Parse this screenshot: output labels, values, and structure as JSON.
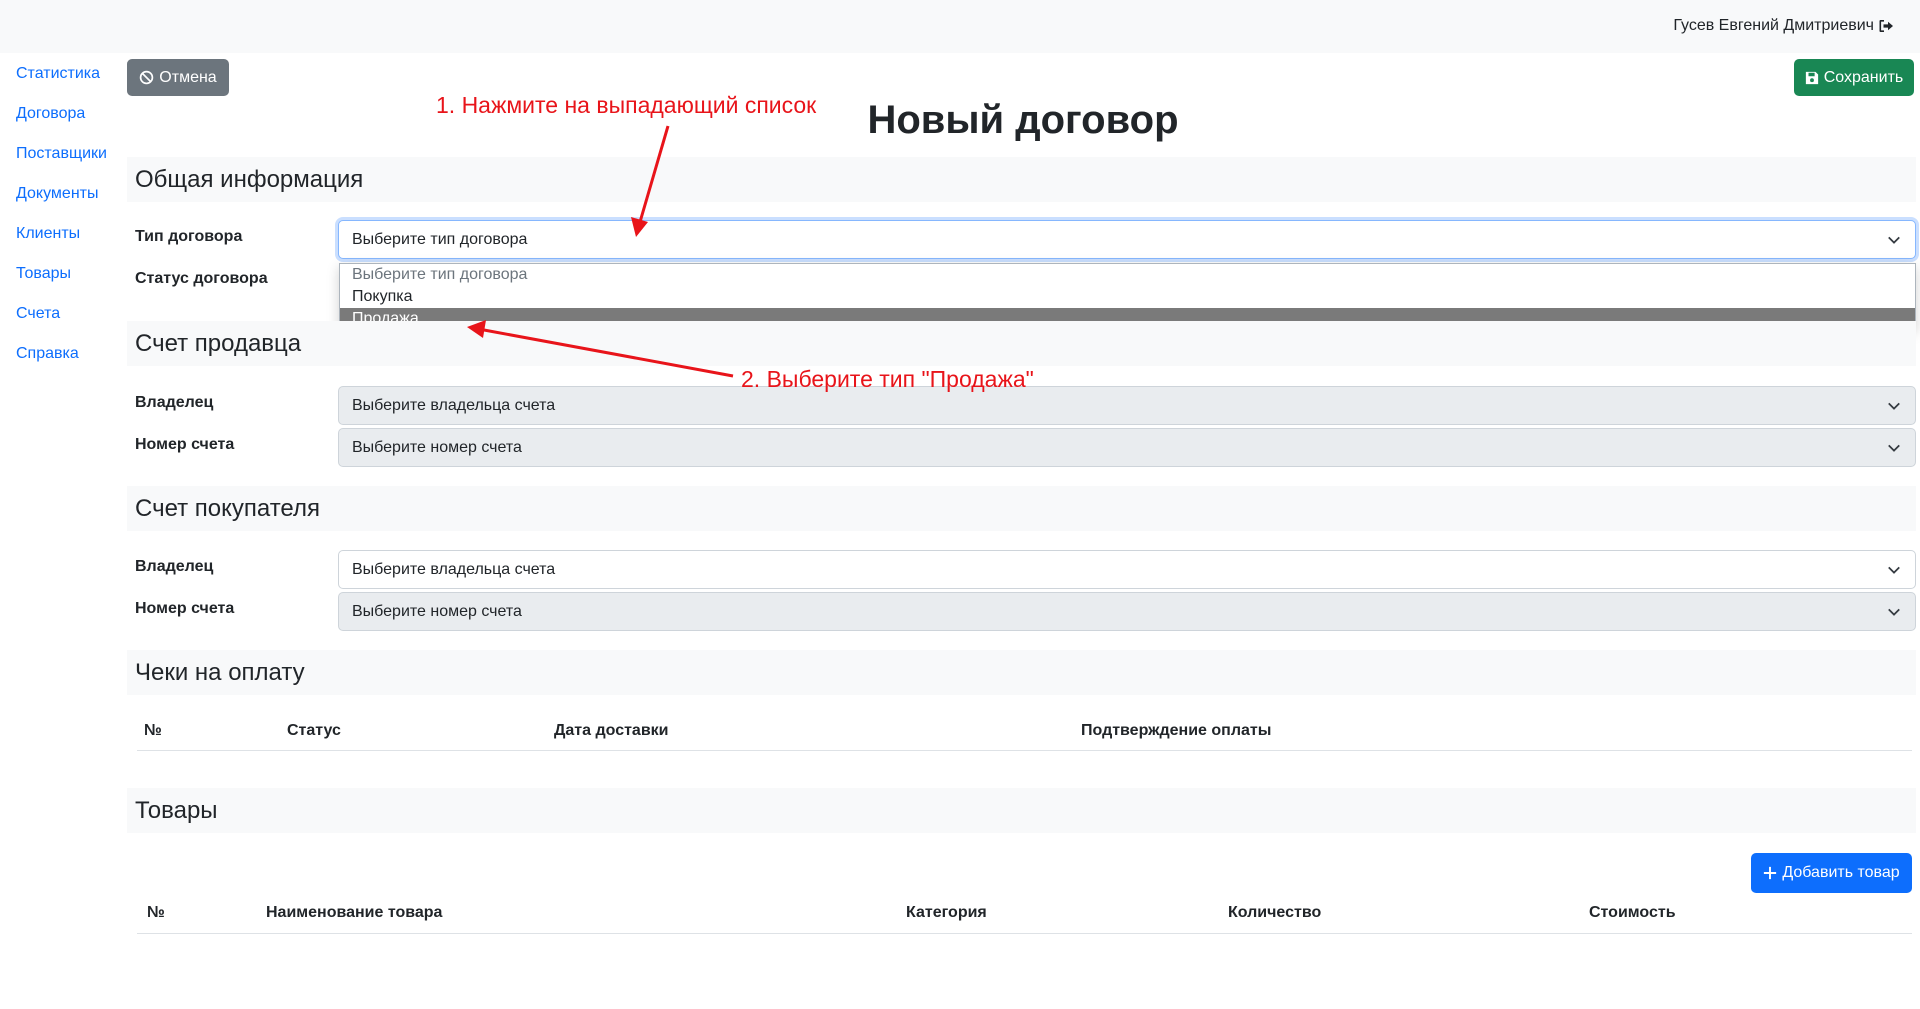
{
  "header": {
    "user_name": "Гусев Евгений Дмитриевич",
    "logout_icon": "sign-out-icon"
  },
  "sidebar": {
    "items": [
      {
        "label": "Статистика"
      },
      {
        "label": "Договора"
      },
      {
        "label": "Поставщики"
      },
      {
        "label": "Документы"
      },
      {
        "label": "Клиенты"
      },
      {
        "label": "Товары"
      },
      {
        "label": "Счета"
      },
      {
        "label": "Справка"
      }
    ]
  },
  "toolbar": {
    "cancel_label": "Отмена",
    "cancel_icon": "ban-icon",
    "save_label": "Сохранить",
    "save_icon": "floppy-disk-icon"
  },
  "page": {
    "title": "Новый договор"
  },
  "general": {
    "title": "Общая информация",
    "type_label": "Тип договора",
    "type_value": "Выберите тип договора",
    "status_label": "Статус договора",
    "dropdown_options": [
      "Выберите тип договора",
      "Покупка",
      "Продажа"
    ],
    "dropdown_selected": "Продажа"
  },
  "seller": {
    "title": "Счет продавца",
    "owner_label": "Владелец",
    "owner_value": "Выберите владельца счета",
    "account_label": "Номер счета",
    "account_value": "Выберите номер счета"
  },
  "buyer": {
    "title": "Счет покупателя",
    "owner_label": "Владелец",
    "owner_value": "Выберите владельца счета",
    "account_label": "Номер счета",
    "account_value": "Выберите номер счета"
  },
  "checks": {
    "title": "Чеки на оплату",
    "columns": [
      "№",
      "Статус",
      "Дата доставки",
      "Подтверждение оплаты"
    ]
  },
  "goods": {
    "title": "Товары",
    "add_label": "Добавить товар",
    "add_icon": "plus-icon",
    "columns": [
      "№",
      "Наименование товара",
      "Категория",
      "Количество",
      "Стоимость"
    ]
  },
  "annotations": {
    "step1": "1. Нажмите на выпадающий список",
    "step2": "2. Выберите тип \"Продажа\"",
    "color": "#e8141a"
  },
  "colors": {
    "primary": "#0d6efd",
    "success": "#198754",
    "secondary": "#6c757d"
  }
}
